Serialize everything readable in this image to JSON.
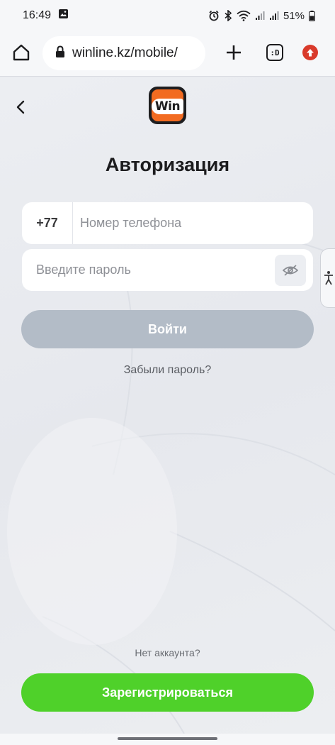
{
  "status_bar": {
    "time": "16:49",
    "battery": "51%",
    "icons": [
      "image-icon",
      "alarm-icon",
      "bluetooth-icon",
      "wifi-icon",
      "signal-icon",
      "signal-icon-2",
      "battery-icon"
    ]
  },
  "browser": {
    "url": "winline.kz/mobile/",
    "tabs_label": ":D",
    "icons": [
      "home-icon",
      "lock-icon",
      "plus-icon",
      "tabs-icon",
      "update-icon"
    ]
  },
  "page": {
    "logo_text": "Win",
    "title": "Авторизация",
    "phone": {
      "prefix": "+77",
      "placeholder": "Номер телефона",
      "value": ""
    },
    "password": {
      "placeholder": "Введите пароль",
      "value": ""
    },
    "login_label": "Войти",
    "forgot_label": "Забыли пароль?",
    "no_account_label": "Нет аккаунта?",
    "register_label": "Зарегистрироваться"
  },
  "colors": {
    "brand_orange": "#f26b21",
    "login_disabled": "#b3bcc7",
    "register_green": "#4fd12a",
    "update_red": "#d93a2b"
  }
}
